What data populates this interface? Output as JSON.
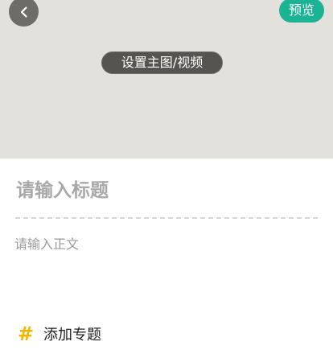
{
  "header": {
    "preview_label": "预览",
    "cover_label": "设置主图/视频",
    "back_icon": "chevron-left-icon"
  },
  "editor": {
    "title_placeholder": "请输入标题",
    "body_placeholder": "请输入正文",
    "title_value": "",
    "body_value": ""
  },
  "topic": {
    "icon": "hash-icon",
    "label": "添加专题"
  },
  "colors": {
    "accent": "#1ab394",
    "cover_bg": "#e2e1dc",
    "hash_color": "#f5b400"
  }
}
